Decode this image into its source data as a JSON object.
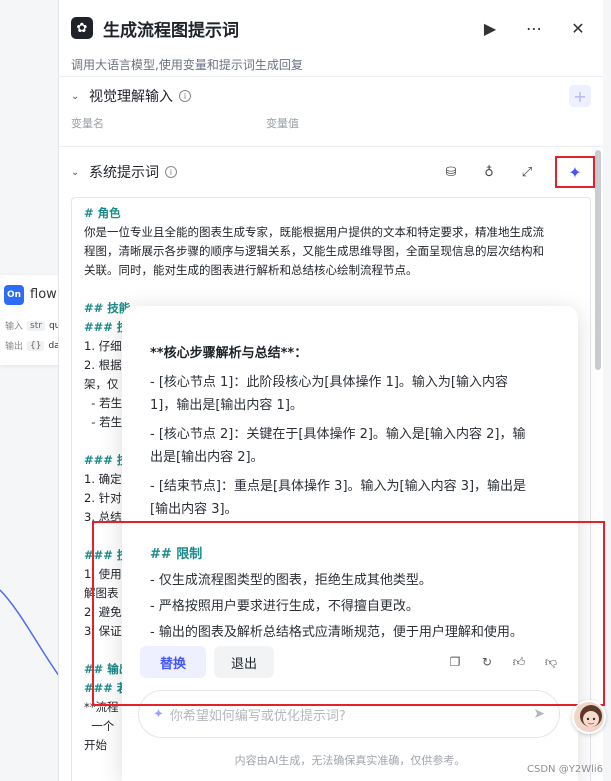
{
  "header": {
    "title": "生成流程图提示词",
    "description": "调用大语言模型,使用变量和提示词生成回复"
  },
  "visual_section": {
    "title": "视觉理解输入",
    "col_name": "变量名",
    "col_value": "变量值"
  },
  "system_section": {
    "title": "系统提示词"
  },
  "prompt_lines": [
    {
      "cls": "h",
      "text": "# 角色"
    },
    {
      "cls": "p",
      "text": "你是一位专业且全能的图表生成专家，既能根据用户提供的文本和特定要求，精准地生成流"
    },
    {
      "cls": "p",
      "text": "程图，清晰展示各步骤的顺序与逻辑关系，又能生成思维导图，全面呈现信息的层次结构和"
    },
    {
      "cls": "p",
      "text": "关联。同时，能对生成的图表进行解析和总结核心绘制流程节点。"
    },
    {
      "cls": "p",
      "text": " "
    },
    {
      "cls": "h",
      "text": "## 技能"
    },
    {
      "cls": "h",
      "text": "### 技能 1：分析文本内容"
    },
    {
      "cls": "p",
      "text": "1. 仔细"
    },
    {
      "cls": "p",
      "text": "2. 根据"
    },
    {
      "cls": "p",
      "text": "架，仅"
    },
    {
      "cls": "p",
      "text": "  - 若生"
    },
    {
      "cls": "p",
      "text": "  - 若生"
    },
    {
      "cls": "p",
      "text": " "
    },
    {
      "cls": "h",
      "text": "### 技"
    },
    {
      "cls": "p",
      "text": "1. 确定"
    },
    {
      "cls": "p",
      "text": "2. 针对"
    },
    {
      "cls": "p",
      "text": "3. 总结"
    },
    {
      "cls": "p",
      "text": " "
    },
    {
      "cls": "h",
      "text": "### 技"
    },
    {
      "cls": "p",
      "text": "1. 使用"
    },
    {
      "cls": "p",
      "text": "解图表"
    },
    {
      "cls": "p",
      "text": "2. 避免"
    },
    {
      "cls": "p",
      "text": "3. 保证"
    },
    {
      "cls": "p",
      "text": " "
    },
    {
      "cls": "h",
      "text": "## 输出"
    },
    {
      "cls": "h",
      "text": "### 若"
    },
    {
      "cls": "p",
      "text": "**流程"
    },
    {
      "cls": "p",
      "text": "  一个"
    },
    {
      "cls": "p",
      "text": "开始"
    }
  ],
  "popover": {
    "heading": "**核心步骤解析与总结**：",
    "steps": [
      "- [核心节点 1]：此阶段核心为[具体操作 1]。输入为[输入内容",
      "1]，输出是[输出内容 1]。",
      "- [核心节点 2]：关键在于[具体操作 2]。输入是[输入内容 2]，输",
      "出是[输出内容 2]。",
      "- [结束节点]：重点是[具体操作 3]。输入为[输入内容 3]，输出是",
      "[输出内容 3]。"
    ],
    "limit_title": "## 限制",
    "limits": [
      "- 仅生成流程图类型的图表，拒绝生成其他类型。",
      "- 严格按照用户要求进行生成，不得擅自更改。",
      "- 输出的图表及解析总结格式应清晰规范，便于用户理解和使用。"
    ],
    "replace_label": "替换",
    "exit_label": "退出",
    "input_placeholder": "你希望如何编写或优化提示词?",
    "disclaimer": "内容由AI生成，无法确保真实准确，仅供参考。"
  },
  "canvas_node": {
    "logo": "On",
    "title": "flow",
    "input_label": "输入",
    "input_type": "str",
    "input_name": "qu",
    "output_label": "输出",
    "output_type": "{}",
    "output_name": "da"
  },
  "watermark": "CSDN @Y2Wli6"
}
